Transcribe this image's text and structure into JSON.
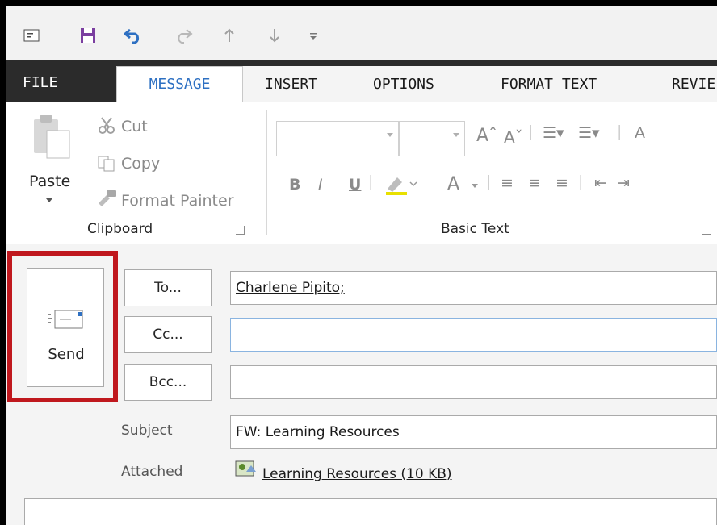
{
  "tabs": [
    {
      "label": "FILE"
    },
    {
      "label": "MESSAGE"
    },
    {
      "label": "INSERT"
    },
    {
      "label": "OPTIONS"
    },
    {
      "label": "FORMAT TEXT"
    },
    {
      "label": "REVIE"
    }
  ],
  "clipboard": {
    "paste_label": "Paste",
    "cut_label": "Cut",
    "copy_label": "Copy",
    "format_painter_label": "Format Painter",
    "group_label": "Clipboard"
  },
  "basic_text": {
    "group_label": "Basic Text",
    "bold": "B",
    "italic": "I",
    "underline": "U",
    "font_color": "A"
  },
  "compose": {
    "send_label": "Send",
    "to_label": "To...",
    "cc_label": "Cc...",
    "bcc_label": "Bcc...",
    "to_value": "Charlene Pipito;",
    "cc_value": "",
    "bcc_value": "",
    "subject_label": "Subject",
    "subject_value": "FW: Learning Resources",
    "attached_label": "Attached",
    "attachment_name": "Learning Resources (10 KB)"
  },
  "colors": {
    "accent": "#2e70c2",
    "highlight": "#c0181e",
    "tabbar": "#2b2b2b",
    "save_icon": "#7b3fa0"
  },
  "icons": {
    "qat": [
      "message-icon",
      "save-icon",
      "undo-icon",
      "redo-icon",
      "up-arrow-icon",
      "down-arrow-icon",
      "customize-icon"
    ],
    "send": "envelope-send-icon",
    "attachment": "attachment-file-icon"
  }
}
